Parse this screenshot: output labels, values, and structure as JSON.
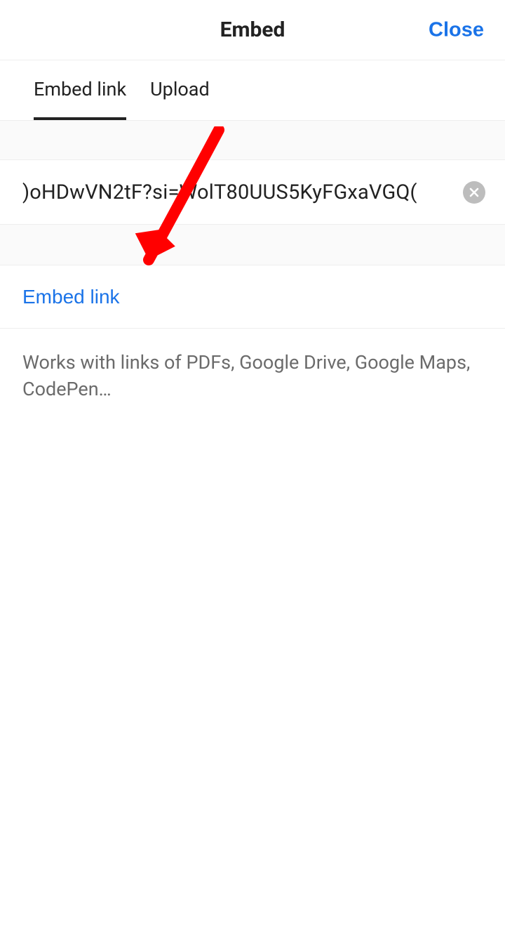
{
  "header": {
    "title": "Embed",
    "close_label": "Close"
  },
  "tabs": {
    "embed_link_label": "Embed link",
    "upload_label": "Upload"
  },
  "input": {
    "value": ")oHDwVN2tF?si=WolT80UUS5KyFGxaVGQ("
  },
  "action": {
    "embed_link_label": "Embed link"
  },
  "help": {
    "text": "Works with links of PDFs, Google Drive, Google Maps, CodePen…"
  }
}
